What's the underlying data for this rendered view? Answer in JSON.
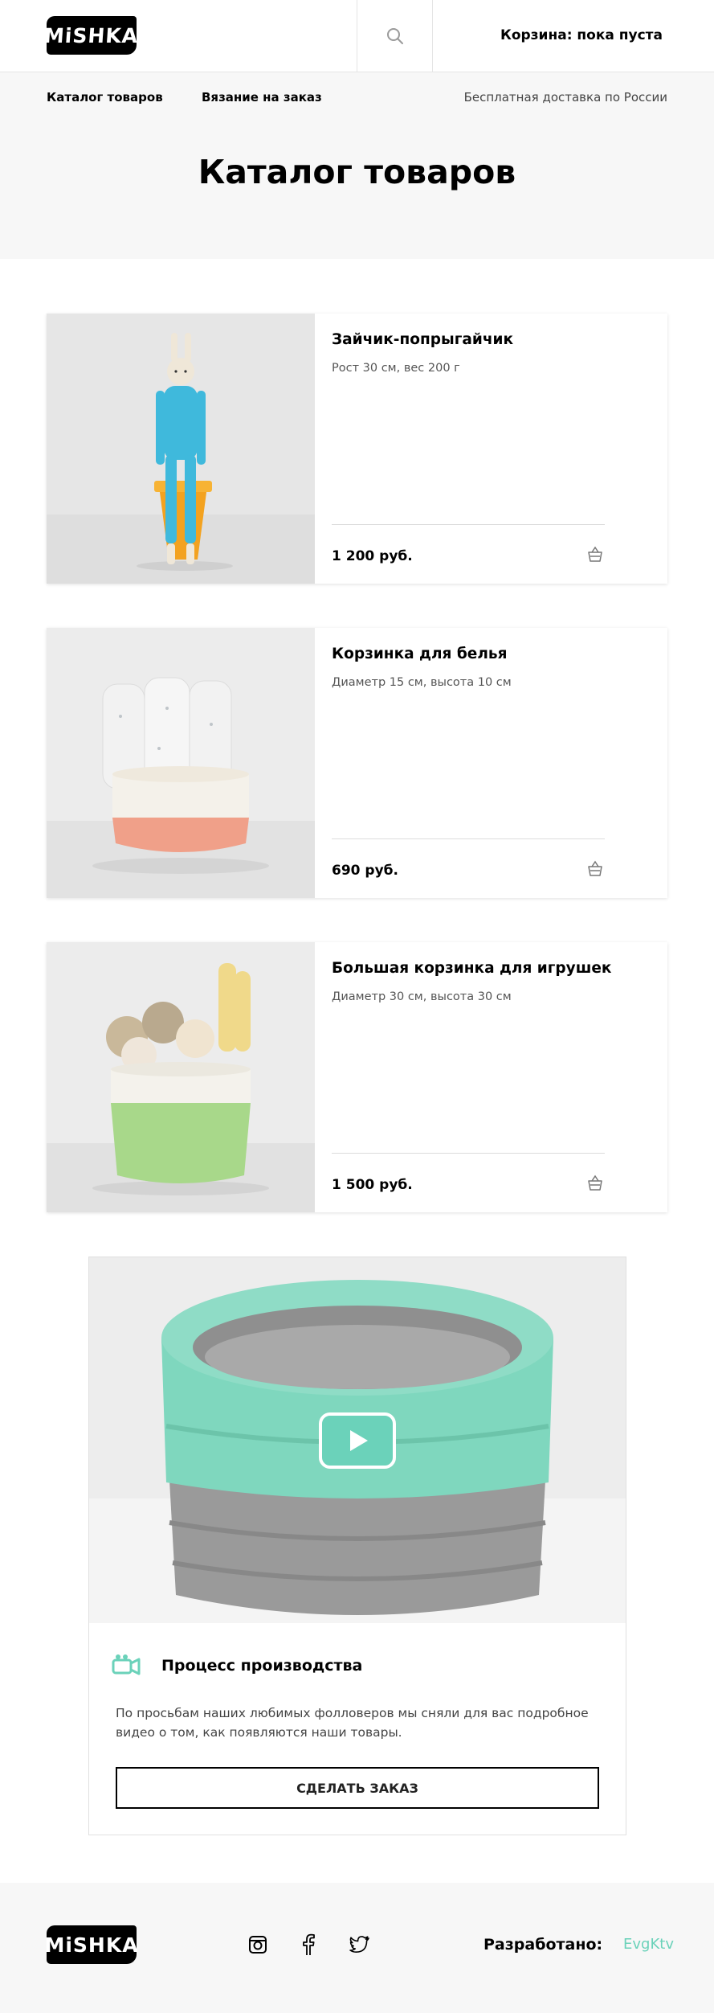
{
  "header": {
    "logo_text": "MiSHKA",
    "cart_label": "Корзина: пока пуста"
  },
  "nav": {
    "catalog": "Каталог товаров",
    "order": "Вязание на заказ",
    "delivery": "Бесплатная доставка по России"
  },
  "page_title": "Каталог товаров",
  "products": [
    {
      "title": "Зайчик-попрыгайчик",
      "desc": "Рост 30 см, вес 200 г",
      "price": "1 200 руб."
    },
    {
      "title": "Корзинка для белья",
      "desc": "Диаметр 15 см, высота 10 см",
      "price": "690 руб."
    },
    {
      "title": "Большая корзинка для игрушек",
      "desc": "Диаметр 30 см, высота 30 см",
      "price": "1 500 руб."
    }
  ],
  "video": {
    "title": "Процесс производства",
    "text": "По просьбам наших любимых фолловеров мы сняли для вас подробное видео о том, как появляются наши товары.",
    "button": "СДЕЛАТЬ ЗАКАЗ"
  },
  "footer": {
    "logo_text": "MiSHKA",
    "dev_label": "Разработано:",
    "dev_name": "EvgKtv"
  },
  "colors": {
    "accent": "#6bd2ba",
    "hero_bg": "#f7f7f7",
    "text": "#000000"
  },
  "icons": [
    "search-icon",
    "basket-icon",
    "play-icon",
    "camera-icon",
    "instagram-icon",
    "facebook-icon",
    "twitter-icon"
  ]
}
